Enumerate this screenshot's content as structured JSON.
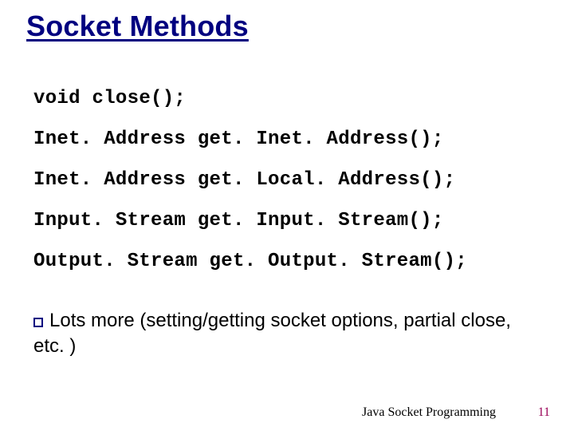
{
  "title": "Socket Methods",
  "methods": {
    "m1": "void close();",
    "m2": "Inet. Address get. Inet. Address();",
    "m3": "Inet. Address get. Local. Address();",
    "m4": "Input. Stream get. Input. Stream();",
    "m5": "Output. Stream get. Output. Stream();"
  },
  "note": {
    "text": "Lots more (setting/getting socket options, partial close, etc. )"
  },
  "footer": {
    "title": "Java Socket Programming",
    "page": "11"
  }
}
